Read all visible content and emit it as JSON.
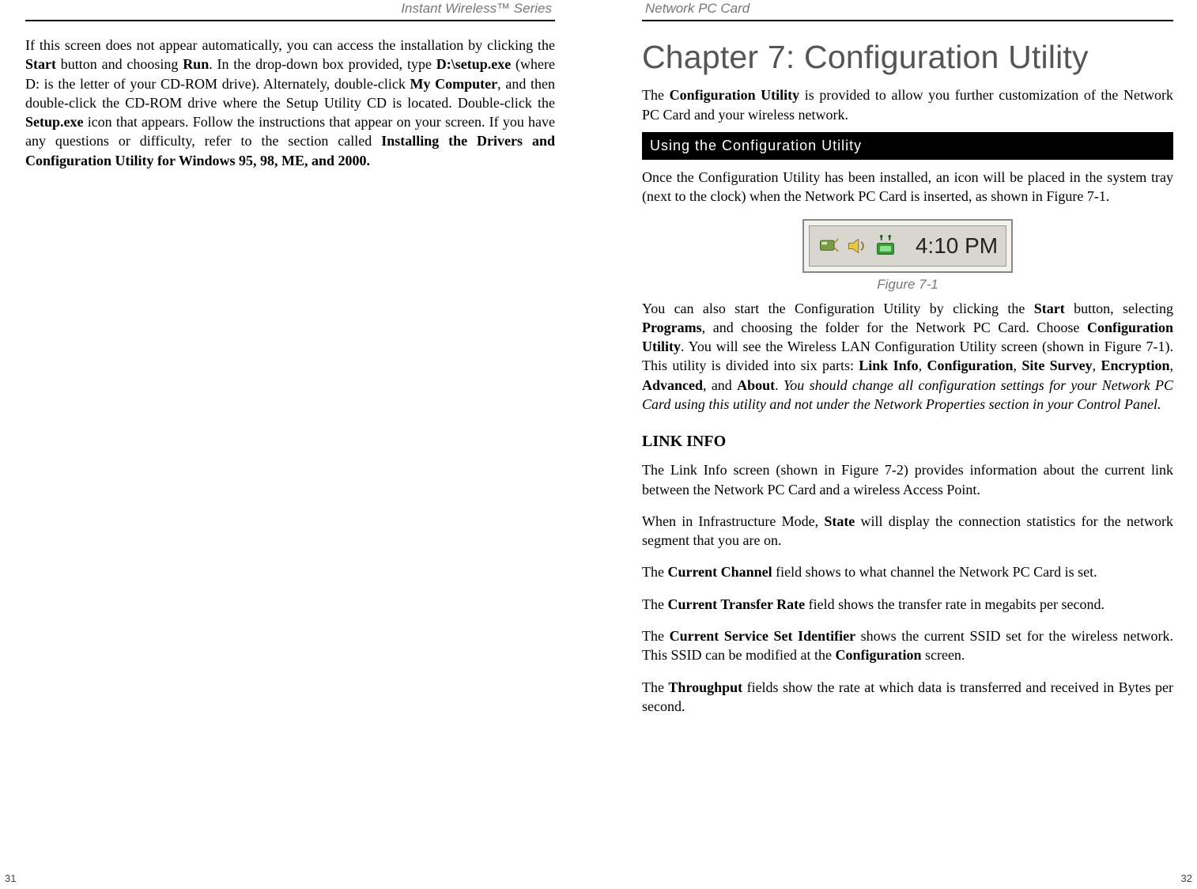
{
  "left": {
    "header": "Instant Wireless™ Series",
    "page_num": "31",
    "p1_a": "If this screen does not appear automatically, you can access the installation by clicking the ",
    "p1_b": "Start",
    "p1_c": " button and choosing ",
    "p1_d": "Run",
    "p1_e": ".  In the drop-down box provided, type ",
    "p1_f": "D:\\setup.exe",
    "p1_g": " (where D: is the letter of your CD-ROM drive). Alternately, double-click ",
    "p1_h": "My Computer",
    "p1_i": ", and then double-click the CD-ROM drive where the Setup Utility CD is located.  Double-click the ",
    "p1_j": "Setup.exe",
    "p1_k": " icon that appears. Follow the instructions that appear on your screen.  If you have any questions or difficulty, refer to the section called ",
    "p1_l": "Installing the Drivers and Configuration Utility for Windows 95, 98, ME, and 2000."
  },
  "right": {
    "header": "Network PC Card",
    "page_num": "32",
    "chapter_title": "Chapter 7: Configuration Utility",
    "intro_a": "The ",
    "intro_b": "Configuration Utility",
    "intro_c": " is provided to allow you further customization of the Network PC Card and your wireless network.",
    "section_bar": "Using the Configuration Utility",
    "p2": "Once the Configuration Utility has been installed, an icon will be placed in the system tray (next to the clock) when the Network PC Card is inserted, as shown in Figure 7-1.",
    "fig_caption": "Figure 7-1",
    "clock": "4:10 PM",
    "p3_a": "You can also start the Configuration Utility by clicking the ",
    "p3_b": "Start",
    "p3_c": " button, selecting ",
    "p3_d": "Programs",
    "p3_e": ",  and choosing the folder for the Network PC Card.  Choose ",
    "p3_f": "Configuration Utility",
    "p3_g": ".  You will see the Wireless LAN Configuration Utility screen (shown in Figure 7-1). This utility is divided into six parts: ",
    "p3_h": "Link Info",
    "p3_i": ", ",
    "p3_j": "Configuration",
    "p3_k": ", ",
    "p3_l": "Site Survey",
    "p3_m": ", ",
    "p3_n": "Encryption",
    "p3_o": ",  ",
    "p3_p": "Advanced",
    "p3_q": ", and ",
    "p3_r": "About",
    "p3_s": ".  ",
    "p3_t": "You should change all configuration settings for your Network PC Card using this utility and not under the Network Properties section in your Control Panel.",
    "subhead": "LINK INFO",
    "p4": "The Link Info screen (shown in Figure 7-2) provides information about the current link between the Network PC Card and a wireless Access Point.",
    "p5_a": "When in Infrastructure Mode, ",
    "p5_b": "State",
    "p5_c": " will display the connection statistics for the network segment that you are on.",
    "p6_a": "The ",
    "p6_b": "Current Channel",
    "p6_c": " field shows to what channel the Network PC Card is set.",
    "p7_a": "The ",
    "p7_b": "Current Transfer Rate",
    "p7_c": " field shows the transfer rate in megabits per second.",
    "p8_a": "The ",
    "p8_b": "Current Service Set Identifier",
    "p8_c": " shows the current SSID set for the wireless network. This SSID can be modified at the ",
    "p8_d": "Configuration",
    "p8_e": " screen.",
    "p9_a": "The ",
    "p9_b": "Throughput",
    "p9_c": " fields show the rate at which data is transferred and received in Bytes per second."
  }
}
